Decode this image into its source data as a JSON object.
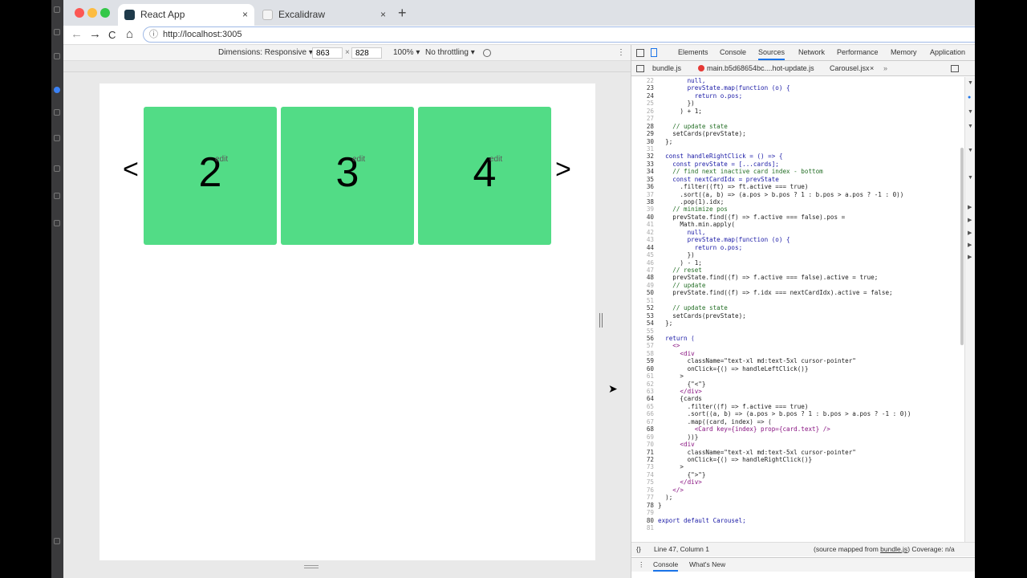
{
  "browser": {
    "tabs": [
      {
        "title": "React App",
        "close": "×",
        "active": true
      },
      {
        "title": "Excalidraw",
        "close": "×",
        "active": false
      }
    ],
    "new_tab": "+",
    "url": "http://localhost:3005",
    "nav": {
      "back": "←",
      "forward": "→",
      "reload": "C",
      "home": "⌂",
      "info": "ⓘ"
    }
  },
  "device_toolbar": {
    "dimensions_label": "Dimensions: Responsive ▾",
    "width": "863",
    "times": "×",
    "height": "828",
    "zoom": "100% ▾",
    "throttling": "No throttling ▾",
    "more": "⋮"
  },
  "carousel": {
    "left_arrow": "<",
    "right_arrow": ">",
    "cards": [
      {
        "number": "2",
        "edit": "edit"
      },
      {
        "number": "3",
        "edit": "edit"
      },
      {
        "number": "4",
        "edit": "edit"
      }
    ],
    "card_color": "#52dc86"
  },
  "devtools": {
    "tabs": [
      "Elements",
      "Console",
      "Sources",
      "Network",
      "Performance",
      "Memory",
      "Application"
    ],
    "active_tab": "Sources",
    "files": [
      "bundle.js",
      "main.b5d68654bc....hot-update.js",
      "Carousel.jsx"
    ],
    "active_file": "Carousel.jsx",
    "file_close": "×",
    "more_tabs": "»",
    "code_lines": [
      {
        "n": "22",
        "text": "        null,"
      },
      {
        "n": "23",
        "text": "        prevState.map(function (o) {"
      },
      {
        "n": "24",
        "text": "          return o.pos;"
      },
      {
        "n": "25",
        "text": "        })"
      },
      {
        "n": "26",
        "text": "      ) + 1;"
      },
      {
        "n": "27",
        "text": ""
      },
      {
        "n": "28",
        "text": "    // update state"
      },
      {
        "n": "29",
        "text": "    setCards(prevState);"
      },
      {
        "n": "30",
        "text": "  };"
      },
      {
        "n": "31",
        "text": ""
      },
      {
        "n": "32",
        "text": "  const handleRightClick = () => {"
      },
      {
        "n": "33",
        "text": "    const prevState = [...cards];"
      },
      {
        "n": "34",
        "text": "    // find next inactive card index - bottom"
      },
      {
        "n": "35",
        "text": "    const nextCardIdx = prevState"
      },
      {
        "n": "36",
        "text": "      .filter((ft) => ft.active === true)"
      },
      {
        "n": "37",
        "text": "      .sort((a, b) => (a.pos > b.pos ? 1 : b.pos > a.pos ? -1 : 0))"
      },
      {
        "n": "38",
        "text": "      .pop(1).idx;"
      },
      {
        "n": "39",
        "text": "    // minimize pos"
      },
      {
        "n": "40",
        "text": "    prevState.find((f) => f.active === false).pos ="
      },
      {
        "n": "41",
        "text": "      Math.min.apply("
      },
      {
        "n": "42",
        "text": "        null,"
      },
      {
        "n": "43",
        "text": "        prevState.map(function (o) {"
      },
      {
        "n": "44",
        "text": "          return o.pos;"
      },
      {
        "n": "45",
        "text": "        })"
      },
      {
        "n": "46",
        "text": "      ) - 1;"
      },
      {
        "n": "47",
        "text": "    // reset"
      },
      {
        "n": "48",
        "text": "    prevState.find((f) => f.active === false).active = true;"
      },
      {
        "n": "49",
        "text": "    // update"
      },
      {
        "n": "50",
        "text": "    prevState.find((f) => f.idx === nextCardIdx).active = false;"
      },
      {
        "n": "51",
        "text": ""
      },
      {
        "n": "52",
        "text": "    // update state"
      },
      {
        "n": "53",
        "text": "    setCards(prevState);"
      },
      {
        "n": "54",
        "text": "  };"
      },
      {
        "n": "55",
        "text": ""
      },
      {
        "n": "56",
        "text": "  return ("
      },
      {
        "n": "57",
        "text": "    <>"
      },
      {
        "n": "58",
        "text": "      <div"
      },
      {
        "n": "59",
        "text": "        className=\"text-xl md:text-5xl cursor-pointer\""
      },
      {
        "n": "60",
        "text": "        onClick={() => handleLeftClick()}"
      },
      {
        "n": "61",
        "text": "      >"
      },
      {
        "n": "62",
        "text": "        {\"<\"}"
      },
      {
        "n": "63",
        "text": "      </div>"
      },
      {
        "n": "64",
        "text": "      {cards"
      },
      {
        "n": "65",
        "text": "        .filter((f) => f.active === true)"
      },
      {
        "n": "66",
        "text": "        .sort((a, b) => (a.pos > b.pos ? 1 : b.pos > a.pos ? -1 : 0))"
      },
      {
        "n": "67",
        "text": "        .map((card, index) => ("
      },
      {
        "n": "68",
        "text": "          <Card key={index} prop={card.text} />"
      },
      {
        "n": "69",
        "text": "        ))}"
      },
      {
        "n": "70",
        "text": "      <div"
      },
      {
        "n": "71",
        "text": "        className=\"text-xl md:text-5xl cursor-pointer\""
      },
      {
        "n": "72",
        "text": "        onClick={() => handleRightClick()}"
      },
      {
        "n": "73",
        "text": "      >"
      },
      {
        "n": "74",
        "text": "        {\">\"}"
      },
      {
        "n": "75",
        "text": "      </div>"
      },
      {
        "n": "76",
        "text": "    </>"
      },
      {
        "n": "77",
        "text": "  );"
      },
      {
        "n": "78",
        "text": "}"
      },
      {
        "n": "79",
        "text": ""
      },
      {
        "n": "80",
        "text": "export default Carousel;"
      },
      {
        "n": "81",
        "text": ""
      }
    ],
    "status": {
      "braces": "{}",
      "position": "Line 47, Column 1",
      "source_mapped_prefix": "(source mapped from ",
      "source_link": "bundle.js",
      "source_mapped_suffix": ") Coverage: n/a"
    },
    "drawer": {
      "more": "⋮",
      "tabs": [
        "Console",
        "What's New"
      ],
      "close": "×"
    }
  }
}
